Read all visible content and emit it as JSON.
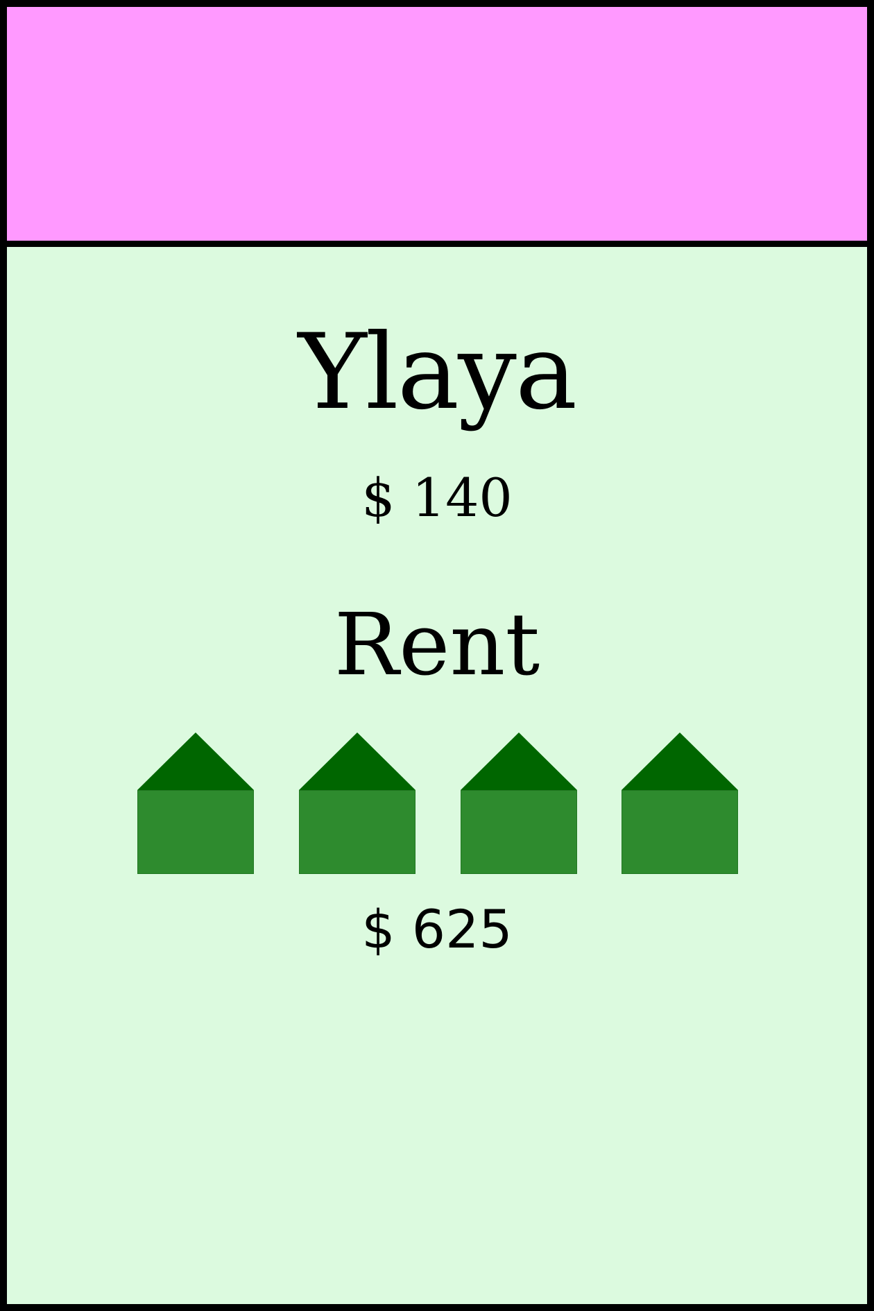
{
  "card": {
    "name": "Ylaya",
    "price": "$ 140",
    "rent_label": "Rent",
    "rent_value": "$ 625",
    "house_count": 4,
    "colors": {
      "band": "#ff99ff",
      "background": "#dcfadf",
      "house_roof": "#006600",
      "house_body": "#2e8b2e",
      "border": "#000000"
    }
  }
}
